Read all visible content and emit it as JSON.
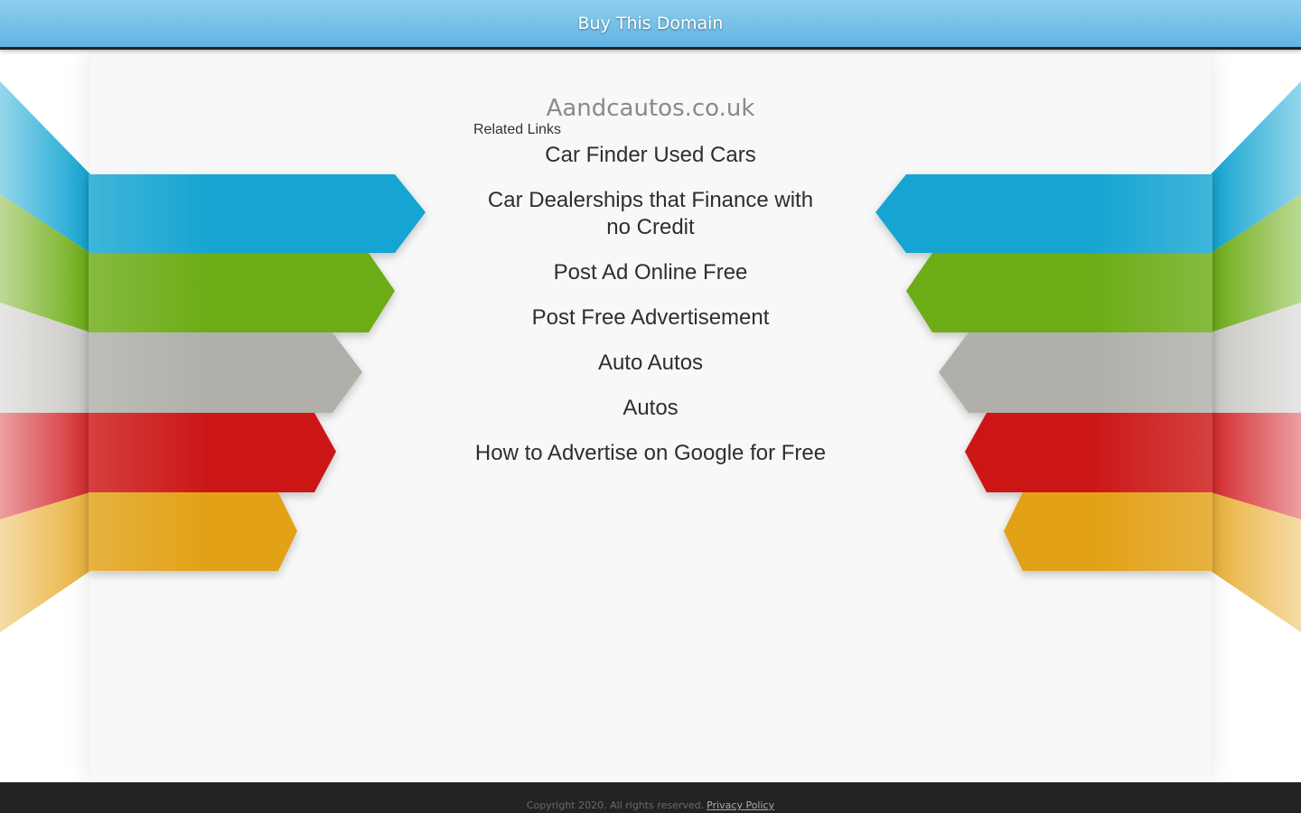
{
  "header": {
    "buy_label": "Buy This Domain"
  },
  "main": {
    "domain_title": "Aandcautos.co.uk",
    "related_heading": "Related Links",
    "links": [
      "Car Finder Used Cars",
      "Car Dealerships that Finance with no Credit",
      "Post Ad Online Free",
      "Post Free Advertisement",
      "Auto Autos",
      "Autos",
      "How to Advertise on Google for Free"
    ]
  },
  "footer": {
    "copyright": "Copyright 2020. All rights reserved.",
    "privacy_label": "Privacy Policy"
  },
  "colors": {
    "topbar": "#6ab8e6",
    "ribbon_blue": "#12a5d2",
    "ribbon_green": "#6cac14",
    "ribbon_gray": "#b0afaa",
    "ribbon_red": "#cc1518",
    "ribbon_yellow": "#e2a114",
    "footer": "#232323"
  }
}
